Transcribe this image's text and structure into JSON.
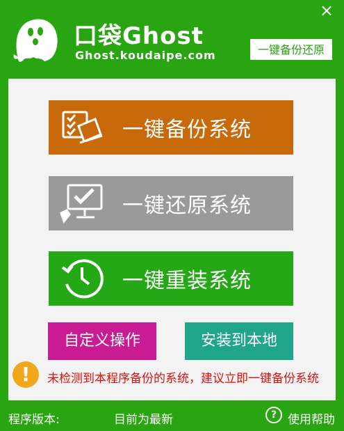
{
  "header": {
    "brand": "口袋Ghost",
    "domain": "Ghost.koudaipe.com",
    "close_icon": "×",
    "restore_link": "一键备份还原"
  },
  "main": {
    "backup_label": "一键备份系统",
    "restore_label": "一键还原系统",
    "reinstall_label": "一键重装系统",
    "custom_label": "自定义操作",
    "install_label": "安装到本地",
    "warning_symbol": "!",
    "warning_text": "未检测到本程序备份的系统，建议立即一键备份系统"
  },
  "footer": {
    "version_label": "程序版本:",
    "version_value": "目前为最新",
    "help_symbol": "?",
    "help_label": "使用帮助"
  },
  "colors": {
    "window": "#2aa512",
    "backup": "#c8690a",
    "restore": "#9a9a9a",
    "reinstall": "#25a816",
    "custom": "#c81b94",
    "install": "#1ea58a",
    "warning": "#f0a81a"
  },
  "icons": [
    "ghost-logo",
    "close-icon",
    "checklist-laptop-icon",
    "checkmark-monitor-icon",
    "history-clock-icon",
    "warning-icon",
    "help-icon"
  ]
}
